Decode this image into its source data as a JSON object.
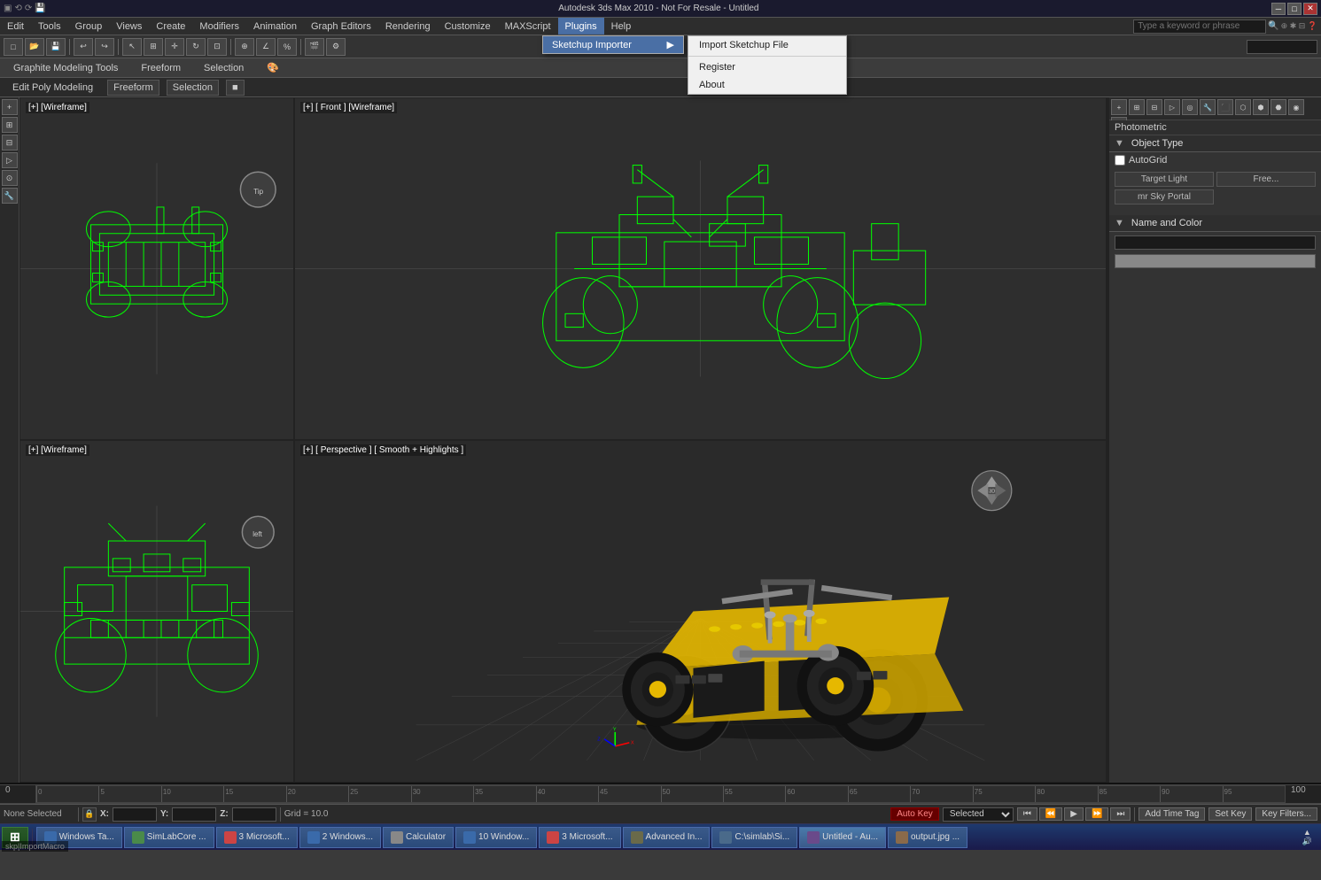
{
  "titlebar": {
    "title": "Autodesk 3ds Max 2010 - Not For Resale - Untitled",
    "quickaccess_items": [
      "undo",
      "redo",
      "open",
      "save"
    ],
    "wincontrols": [
      "─",
      "□",
      "✕"
    ]
  },
  "menubar": {
    "items": [
      {
        "id": "edit",
        "label": "Edit"
      },
      {
        "id": "tools",
        "label": "Tools"
      },
      {
        "id": "group",
        "label": "Group"
      },
      {
        "id": "views",
        "label": "Views"
      },
      {
        "id": "create",
        "label": "Create"
      },
      {
        "id": "modifiers",
        "label": "Modifiers"
      },
      {
        "id": "animation",
        "label": "Animation"
      },
      {
        "id": "graph-editors",
        "label": "Graph Editors"
      },
      {
        "id": "rendering",
        "label": "Rendering"
      },
      {
        "id": "customize",
        "label": "Customize"
      },
      {
        "id": "maxscript",
        "label": "MAXScript"
      },
      {
        "id": "plugins",
        "label": "Plugins",
        "active": true
      },
      {
        "id": "help",
        "label": "Help"
      }
    ],
    "search_placeholder": "Type a keyword or phrase"
  },
  "plugins_menu": {
    "label": "Plugins",
    "submenu_trigger": "Sketchup Importer",
    "submenu_arrow": "▶",
    "subitems": [
      {
        "id": "import-sketchup",
        "label": "Import Sketchup File"
      },
      {
        "id": "register",
        "label": "Register"
      },
      {
        "id": "about",
        "label": "About"
      }
    ]
  },
  "toolbar": {
    "buttons": [
      "↩",
      "↪",
      "□",
      "✱",
      "⊞",
      "▷",
      "◁",
      "⊕",
      "✕",
      "◎",
      "⊙"
    ]
  },
  "ribbon": {
    "tabs": [
      {
        "id": "graphite",
        "label": "Graphite Modeling Tools",
        "active": false
      },
      {
        "id": "freeform",
        "label": "Freeform"
      },
      {
        "id": "selection",
        "label": "Selection"
      },
      {
        "id": "object-paint",
        "label": "🎨"
      }
    ]
  },
  "modeling_bar": {
    "title": "Edit Poly Modeling",
    "sections": [
      "Freeform",
      "Selection",
      "■"
    ]
  },
  "viewports": {
    "top_left": {
      "label": "[+] [Wireframe]",
      "type": "wireframe_top"
    },
    "top_right": {
      "label": "[+] [ Front ] [Wireframe]",
      "type": "wireframe_front"
    },
    "bottom_left": {
      "label": "[+] [Wireframe]",
      "type": "wireframe_left"
    },
    "bottom_right": {
      "label": "[+] [ Perspective ] [ Smooth + Highlights ]",
      "type": "perspective_3d"
    }
  },
  "right_panel": {
    "photometric_label": "Photometric",
    "object_type_header": "Object Type",
    "autogrid_label": "AutoGrid",
    "buttons": [
      {
        "id": "target-light",
        "label": "Target Light"
      },
      {
        "id": "free-light",
        "label": "Free..."
      },
      {
        "id": "mr-sky-portal",
        "label": "mr Sky Portal"
      }
    ],
    "name_color_header": "Name and Color",
    "rpanel_icons": [
      "⊞",
      "⊟",
      "◎",
      "⊙",
      "✦",
      "✶",
      "⊕",
      "⊗",
      "▣",
      "◈",
      "▤",
      "▥",
      "◉",
      "⊘"
    ]
  },
  "status_bar": {
    "selection": "None Selected",
    "x_label": "X:",
    "y_label": "Y:",
    "z_label": "Z:",
    "x_value": "",
    "y_value": "",
    "z_value": "",
    "grid_label": "Grid = 10.0",
    "auto_key": "Auto Key",
    "selected_label": "Selected",
    "add_time_tag": "Add Time Tag",
    "set_key": "Set Key",
    "key_filters": "Key Filters..."
  },
  "timeline": {
    "start": "0",
    "end": "100",
    "current": "0",
    "markers": [
      "0",
      "5",
      "10",
      "15",
      "20",
      "25",
      "30",
      "35",
      "40",
      "45",
      "50",
      "55",
      "60",
      "65",
      "70",
      "75",
      "80",
      "85",
      "90",
      "95",
      "100"
    ]
  },
  "animation_controls": {
    "buttons": [
      "⏮",
      "⏪",
      "◀",
      "▶",
      "⏩",
      "⏭"
    ]
  },
  "key_controls": {
    "auto_key_label": "Auto Key",
    "set_key_label": "Set Key",
    "filters_label": "Key Filters..."
  },
  "taskbar": {
    "start_label": "Start",
    "items": [
      {
        "id": "windows-taskbar",
        "label": "Windows Ta..."
      },
      {
        "id": "simlabcore",
        "label": "SimLabCore ..."
      },
      {
        "id": "microsoft-1",
        "label": "3 Microsoft..."
      },
      {
        "id": "windows-2",
        "label": "2 Windows..."
      },
      {
        "id": "calculator",
        "label": "Calculator"
      },
      {
        "id": "windows-3",
        "label": "10 Window..."
      },
      {
        "id": "microsoft-2",
        "label": "3 Microsoft..."
      },
      {
        "id": "advanced-in",
        "label": "Advanced In..."
      },
      {
        "id": "csimlab",
        "label": "C:\\simlab\\Si..."
      },
      {
        "id": "untitled-au",
        "label": "Untitled - Au..."
      },
      {
        "id": "outputjpg",
        "label": "output.jpg ..."
      }
    ],
    "clock": "▲\n◀▶\n🔊",
    "script_label": "skp|ImportMacro"
  },
  "colors": {
    "wireframe_green": "#00ff00",
    "bg_viewport": "#2e2e2e",
    "bg_dark": "#222222",
    "bg_mid": "#333333",
    "bg_light": "#444444",
    "accent_blue": "#4a6fa5",
    "grid_line": "#4a4a4a",
    "menu_highlight": "#4a6fa5"
  }
}
